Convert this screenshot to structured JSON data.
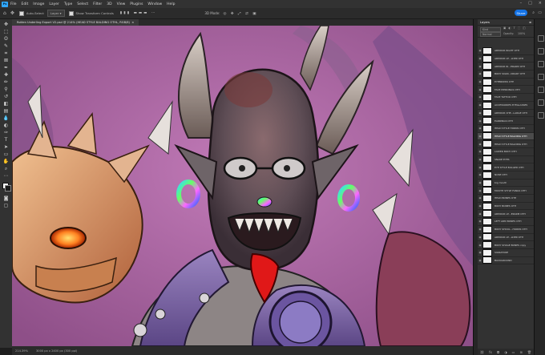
{
  "menubar": {
    "app_icon": "Ps",
    "items": [
      "File",
      "Edit",
      "Image",
      "Layer",
      "Type",
      "Select",
      "Filter",
      "3D",
      "View",
      "Plugins",
      "Window",
      "Help"
    ]
  },
  "options": {
    "auto_select": "Auto-Select",
    "layer_mode": "Layer",
    "show_transform": "Show Transform Controls",
    "share": "Share"
  },
  "document": {
    "tab_title": "Rotten Underling Export V2.psd @ 214% (HEAD STYLE BALDING OTHL, RGB/8)"
  },
  "status": {
    "zoom": "214.39%",
    "info": "3000 px x 2400 px (300 ppi)"
  },
  "layers_panel": {
    "tabs": [
      "Layers"
    ],
    "filter": "Kind",
    "blend": "Normal",
    "opacity": "100%",
    "layers": [
      {
        "name": "ARMOUR RIGHT OTH",
        "selected": false
      },
      {
        "name": "ARMOUR LE...LDER OTH",
        "selected": false
      },
      {
        "name": "ARMOUR RI...ERARM OTH",
        "selected": false
      },
      {
        "name": "BODY SIGNI...NDARY OTH",
        "selected": false
      },
      {
        "name": "EYEBROWS OTH",
        "selected": false
      },
      {
        "name": "FACE PIERCINGS OTH",
        "selected": false
      },
      {
        "name": "FACE TATTOO OTH",
        "selected": false
      },
      {
        "name": "ACCESSORIES EYEGLASSES",
        "selected": false
      },
      {
        "name": "ARMOUR CHE...LARGE OTH",
        "selected": false
      },
      {
        "name": "EARRINGS OTH",
        "selected": false
      },
      {
        "name": "HEAD STYLE HORNS OTH",
        "selected": false
      },
      {
        "name": "HEAD STYLE BALDING OTH",
        "selected": true
      },
      {
        "name": "HEAD STYLE BALDING OTH",
        "selected": false
      },
      {
        "name": "LOWER BODY OTH",
        "selected": false
      },
      {
        "name": "SNAKE EYES",
        "selected": false
      },
      {
        "name": "EYE STYLE BULGED OTH",
        "selected": false
      },
      {
        "name": "NOSE OTH",
        "selected": false
      },
      {
        "name": "big mouth",
        "selected": false
      },
      {
        "name": "MOUTH STYLE FANGS OTH",
        "selected": false
      },
      {
        "name": "HEAD BONES OTH",
        "selected": false
      },
      {
        "name": "BODY BONES OTH",
        "selected": false
      },
      {
        "name": "ARMOUR LE...ERARM OTH",
        "selected": false
      },
      {
        "name": "LEFT ARM BONES OTH",
        "selected": false
      },
      {
        "name": "BODY SHOUL...HORNS OTH",
        "selected": false
      },
      {
        "name": "ARMOUR LE...LDER OTH",
        "selected": false
      },
      {
        "name": "BODY SHAGE BONES copy",
        "selected": false
      },
      {
        "name": "SIGNATURE",
        "selected": false
      },
      {
        "name": "BACKGROUND",
        "selected": false
      }
    ]
  },
  "colors": {
    "canvas_bg": "#b06aa6",
    "accent": "#31a8ff",
    "panel": "#323232"
  }
}
